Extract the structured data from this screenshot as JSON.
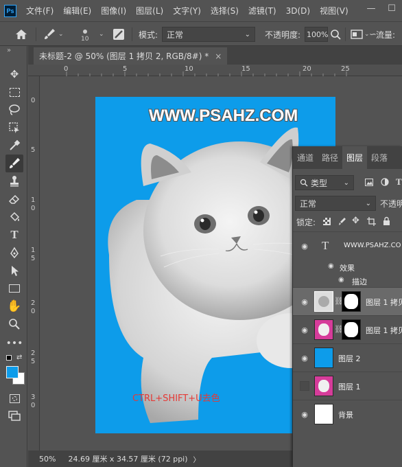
{
  "app": {
    "logo": "Ps"
  },
  "menubar": {
    "items": [
      "文件(F)",
      "编辑(E)",
      "图像(I)",
      "图层(L)",
      "文字(Y)",
      "选择(S)",
      "滤镜(T)",
      "3D(D)",
      "视图(V)"
    ],
    "minimize": "—",
    "maximize": "☐",
    "close": "✕"
  },
  "options": {
    "brush_size": "10",
    "mode_label": "模式:",
    "mode_value": "正常",
    "opacity_label": "不透明度:",
    "opacity_value": "100%",
    "flow_label": "流量:"
  },
  "document": {
    "tab_title": "未标题-2 @ 50% (图层 1 拷贝 2, RGB/8#) *",
    "tab_close": "×",
    "watermark": "WWW.PSAHZ.COM",
    "caption": "CTRL+SHIFT+U去色",
    "background_color": "#0d9cea"
  },
  "rulers": {
    "h_labels": [
      "0",
      "5",
      "10",
      "15",
      "20",
      "25"
    ],
    "v_labels": [
      "0",
      "5",
      "1 0",
      "1 5",
      "2 0",
      "2 5",
      "3 0"
    ]
  },
  "status": {
    "zoom": "50%",
    "doc_info": "24.69 厘米 x 34.57 厘米 (72 ppi)",
    "arrow": "〉"
  },
  "layers_panel": {
    "tabs": [
      "通道",
      "路径",
      "图层",
      "段落"
    ],
    "active_tab": 2,
    "filter_label": "类型",
    "blend_mode": "正常",
    "opacity_label": "不透明",
    "lock_label": "锁定:",
    "layers": [
      {
        "name": "WWW.PSAHZ.CO",
        "type": "text",
        "visible": true
      },
      {
        "name": "效果",
        "type": "effects",
        "visible": true
      },
      {
        "name": "描边",
        "type": "effect",
        "visible": true
      },
      {
        "name": "图层 1 拷贝",
        "type": "masked",
        "visible": true,
        "selected": true
      },
      {
        "name": "图层 1 拷贝",
        "type": "masked-pink",
        "visible": true
      },
      {
        "name": "图层 2",
        "type": "fill",
        "visible": true,
        "color": "#0d9cea"
      },
      {
        "name": "图层 1",
        "type": "image",
        "visible": false
      },
      {
        "name": "背景",
        "type": "white",
        "visible": true
      }
    ]
  }
}
